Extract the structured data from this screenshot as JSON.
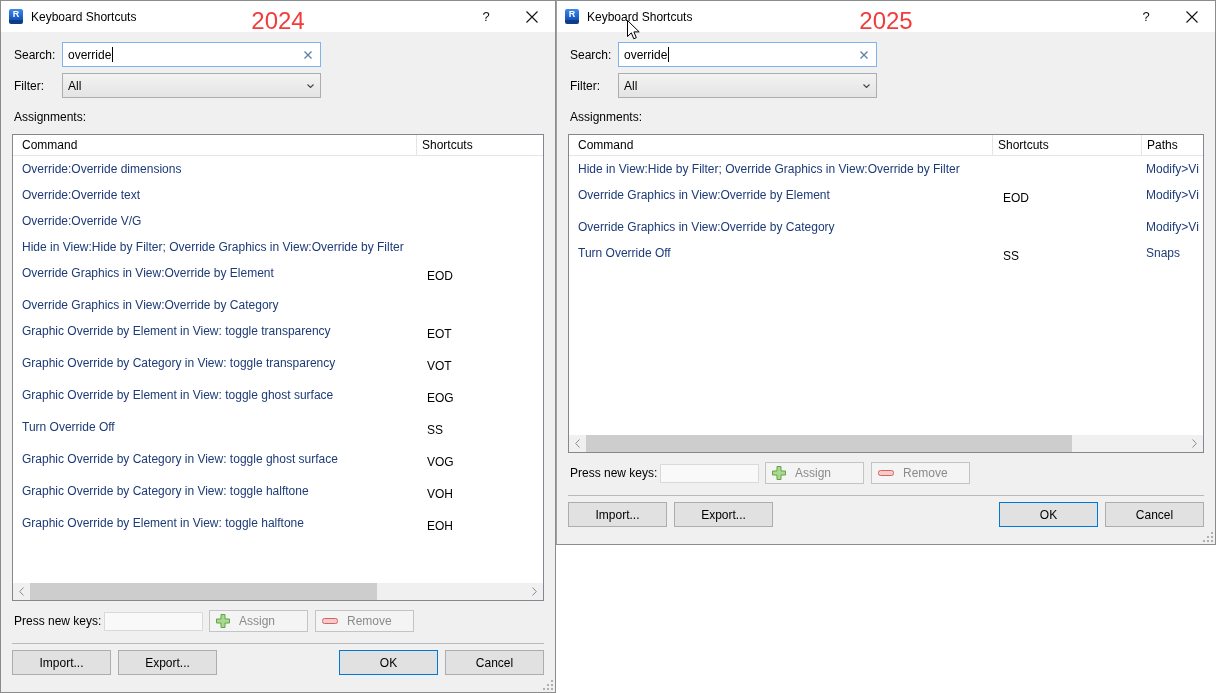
{
  "dialogs": [
    {
      "title": "Keyboard Shortcuts",
      "annotation": "2024",
      "app_badge": "R",
      "help": "?",
      "search": {
        "label": "Search:",
        "value": "override",
        "focused": true
      },
      "filter": {
        "label": "Filter:",
        "value": "All"
      },
      "assignments_label": "Assignments:",
      "table": {
        "columns": [
          "Command",
          "Shortcuts"
        ],
        "rows": [
          {
            "command": "Override:Override dimensions"
          },
          {
            "command": "Override:Override text"
          },
          {
            "command": "Override:Override V/G"
          },
          {
            "command": "Hide in View:Hide by Filter; Override Graphics in View:Override by Filter"
          },
          {
            "command": "Override Graphics in View:Override by Element",
            "shortcuts": "EOD"
          },
          {
            "command": "Override Graphics in View:Override by Category"
          },
          {
            "command": "Graphic Override by Element in View: toggle transparency",
            "shortcuts": "EOT"
          },
          {
            "command": "Graphic Override by Category in View: toggle transparency",
            "shortcuts": "VOT"
          },
          {
            "command": "Graphic Override by Element in View: toggle ghost surface",
            "shortcuts": "EOG"
          },
          {
            "command": "Turn Override Off",
            "shortcuts": "SS"
          },
          {
            "command": "Graphic Override by Category in View: toggle ghost surface",
            "shortcuts": "VOG"
          },
          {
            "command": "Graphic Override by Category in View: toggle halftone",
            "shortcuts": "VOH"
          },
          {
            "command": "Graphic Override by Element in View: toggle halftone",
            "shortcuts": "EOH"
          }
        ]
      },
      "new_keys": {
        "label": "Press new keys:",
        "buttons": [
          {
            "kind": "add",
            "label": "Assign",
            "disabled": true
          },
          {
            "kind": "remove",
            "label": "Remove",
            "disabled": true
          }
        ]
      },
      "footer": {
        "left": [
          {
            "label": "Import...",
            "default": false
          },
          {
            "label": "Export...",
            "default": false
          }
        ],
        "right": [
          {
            "label": "OK",
            "default": true
          },
          {
            "label": "Cancel",
            "default": false
          }
        ]
      }
    },
    {
      "title": "Keyboard Shortcuts",
      "annotation": "2025",
      "app_badge": "R",
      "help": "?",
      "mouse_pointer": true,
      "search": {
        "label": "Search:",
        "value": "override",
        "focused": true
      },
      "filter": {
        "label": "Filter:",
        "value": "All"
      },
      "assignments_label": "Assignments:",
      "table": {
        "columns": [
          "Command",
          "Shortcuts",
          "Paths"
        ],
        "rows": [
          {
            "command": "Hide in View:Hide by Filter; Override Graphics in View:Override by Filter",
            "paths": "Modify>Vi"
          },
          {
            "command": "Override Graphics in View:Override by Element",
            "shortcuts": "EOD",
            "paths": "Modify>Vi"
          },
          {
            "command": "Override Graphics in View:Override by Category",
            "paths": "Modify>Vi"
          },
          {
            "command": "Turn Override Off",
            "shortcuts": "SS",
            "paths": "Snaps"
          }
        ]
      },
      "new_keys": {
        "label": "Press new keys:",
        "buttons": [
          {
            "kind": "add",
            "label": "Assign",
            "disabled": true
          },
          {
            "kind": "remove",
            "label": "Remove",
            "disabled": true
          }
        ]
      },
      "footer": {
        "left": [
          {
            "label": "Import...",
            "default": false
          },
          {
            "label": "Export...",
            "default": false
          }
        ],
        "right": [
          {
            "label": "OK",
            "default": true
          },
          {
            "label": "Cancel",
            "default": false
          }
        ]
      }
    }
  ]
}
